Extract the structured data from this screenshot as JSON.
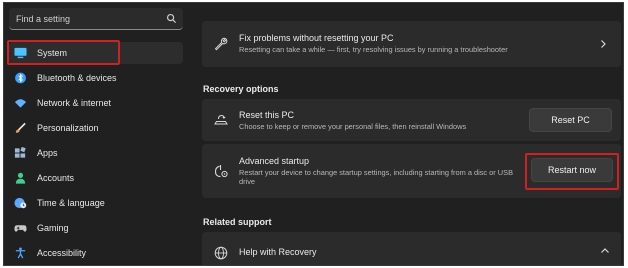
{
  "search": {
    "placeholder": "Find a setting",
    "icon": "search-icon"
  },
  "sidebar": {
    "items": [
      {
        "label": "System",
        "icon": "monitor-icon",
        "color": "#4cc2ff"
      },
      {
        "label": "Bluetooth & devices",
        "icon": "bluetooth-icon",
        "color": "#3aa0ff"
      },
      {
        "label": "Network & internet",
        "icon": "wifi-icon",
        "color": "#5fb2ff"
      },
      {
        "label": "Personalization",
        "icon": "brush-icon",
        "color": "#f0a05a"
      },
      {
        "label": "Apps",
        "icon": "apps-icon",
        "color": "#9fb8d8"
      },
      {
        "label": "Accounts",
        "icon": "person-icon",
        "color": "#3ccf8e"
      },
      {
        "label": "Time & language",
        "icon": "globe-clock-icon",
        "color": "#5aa9ff"
      },
      {
        "label": "Gaming",
        "icon": "gamepad-icon",
        "color": "#c8c8c8"
      },
      {
        "label": "Accessibility",
        "icon": "accessibility-icon",
        "color": "#4fa6ff"
      }
    ]
  },
  "fix_card": {
    "title": "Fix problems without resetting your PC",
    "desc": "Resetting can take a while — first, try resolving issues by running a troubleshooter"
  },
  "recovery_options": {
    "heading": "Recovery options",
    "reset": {
      "title": "Reset this PC",
      "desc": "Choose to keep or remove your personal files, then reinstall Windows",
      "button": "Reset PC"
    },
    "advanced": {
      "title": "Advanced startup",
      "desc": "Restart your device to change startup settings, including starting from a disc or USB drive",
      "button": "Restart now"
    }
  },
  "related_support": {
    "heading": "Related support",
    "help": {
      "title": "Help with Recovery"
    }
  },
  "colors": {
    "highlight_red": "#d21f1f",
    "background": "#202020",
    "card": "#2b2b2b"
  }
}
